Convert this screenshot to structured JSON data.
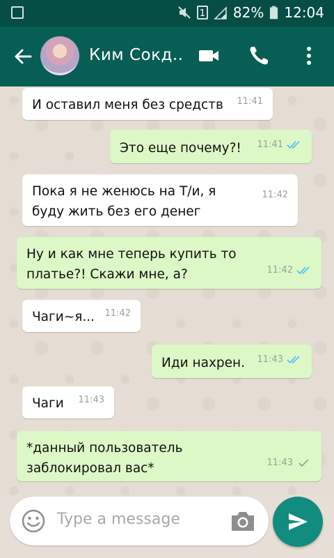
{
  "status_bar": {
    "battery": "82%",
    "time": "12:04",
    "sim_badge": "1"
  },
  "header": {
    "contact_name": "Ким Сокд.."
  },
  "messages": [
    {
      "direction": "in",
      "text": "И оставил меня без средств",
      "time": "11:41"
    },
    {
      "direction": "out",
      "text": "Это еще почему?!",
      "time": "11:41",
      "status": "read"
    },
    {
      "direction": "in",
      "text": "Пока я не женюсь на Т/и, я буду жить без его денег",
      "time": "11:42"
    },
    {
      "direction": "out",
      "text": "Ну и как мне теперь купить то платье?! Скажи мне, а?",
      "time": "11:42",
      "status": "read"
    },
    {
      "direction": "in",
      "text": "Чаги~я...",
      "time": "11:42"
    },
    {
      "direction": "out",
      "text": "Иди нахрен.",
      "time": "11:43",
      "status": "read"
    },
    {
      "direction": "in",
      "text": "Чаги",
      "time": "11:43"
    },
    {
      "direction": "out",
      "text": "*данный пользователь заблокировал вас*",
      "time": "11:43",
      "status": "sent"
    }
  ],
  "composer": {
    "placeholder": "Type a message"
  },
  "colors": {
    "header": "#075e54",
    "status_bar": "#064d45",
    "outgoing_bubble": "#dcf8c6",
    "incoming_bubble": "#ffffff",
    "read_ticks": "#4fc3f7",
    "send_button": "#128c7e"
  },
  "icons": {
    "back": "arrow-left-icon",
    "video": "video-call-icon",
    "call": "phone-icon",
    "menu": "more-vert-icon",
    "emoji": "emoji-icon",
    "camera": "camera-icon",
    "send": "send-icon"
  }
}
